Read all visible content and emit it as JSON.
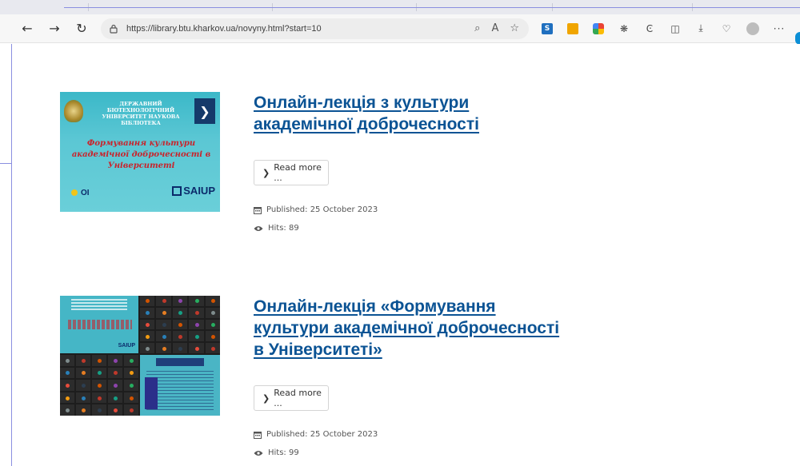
{
  "browser": {
    "url": "https://library.btu.kharkov.ua/novyny.html?start=10"
  },
  "toolbar_icons": [
    "back-icon",
    "forward-icon",
    "reload-icon",
    "lock-icon",
    "zoom-icon",
    "read-aloud-icon",
    "favorite-icon",
    "extension-s-icon",
    "extension-office-icon",
    "extension-google-icon",
    "extension-puzzle-icon",
    "extension-copilot-icon",
    "split-screen-icon",
    "downloads-icon",
    "heart-pulse-icon",
    "profile-avatar",
    "more-icon"
  ],
  "articles": [
    {
      "title": "Онлайн-лекція з культури академічної доброчесності",
      "read_more": "Read more ...",
      "published": "Published: 25 October 2023",
      "hits": "Hits: 89",
      "thumbnail": {
        "header": "ДЕРЖАВНИЙ БІОТЕХНОЛОГІЧНИЙ УНІВЕРСИТЕТ НАУКОВА БІБЛІОТЕКА",
        "headline": "Формування культури академічної доброчесності в Університеті",
        "brand": "SAIUP",
        "logo_oi": "OI"
      }
    },
    {
      "title": "Онлайн-лекція «Формування культури академічної доброчесності в Університеті»",
      "read_more": "Read more ...",
      "published": "Published: 25 October 2023",
      "hits": "Hits: 99",
      "thumbnail": {
        "brand": "SAIUP"
      }
    }
  ]
}
